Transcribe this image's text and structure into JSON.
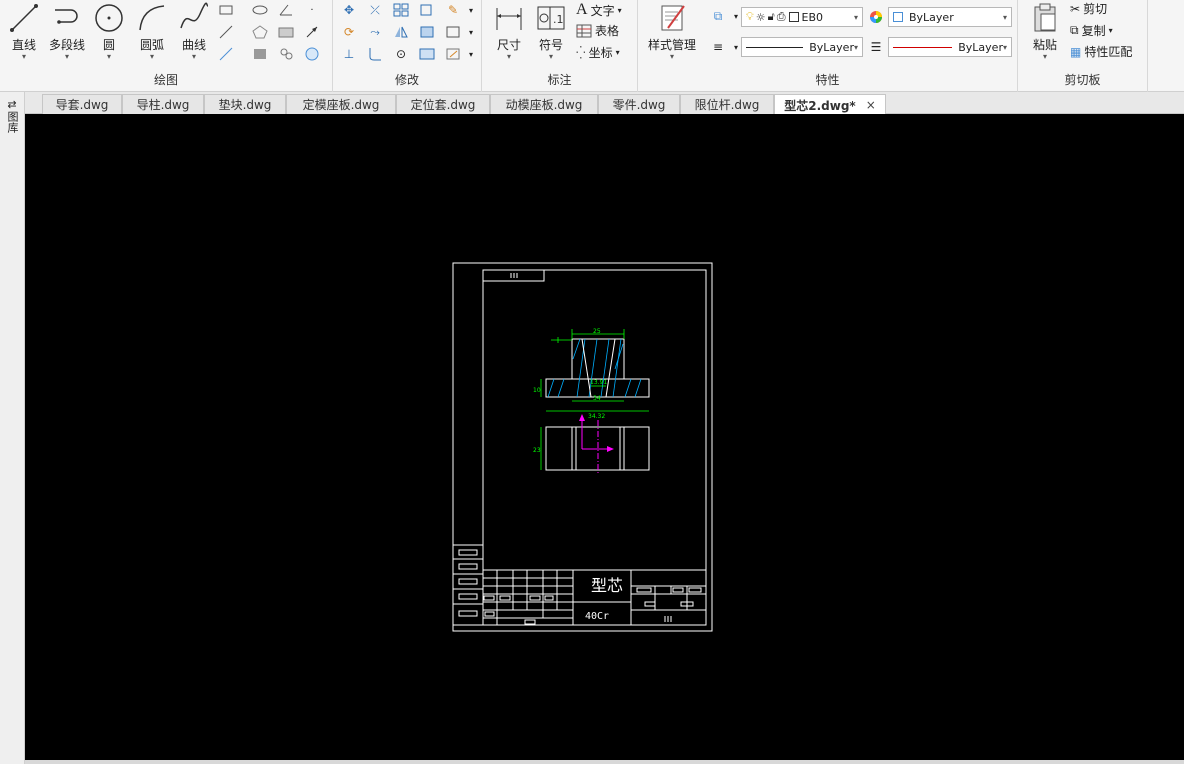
{
  "ribbon": {
    "draw": {
      "title": "绘图",
      "line": "直线",
      "polyline": "多段线",
      "circle": "圆",
      "arc": "圆弧",
      "curve": "曲线"
    },
    "modify": {
      "title": "修改"
    },
    "annotate": {
      "title": "标注",
      "dimension": "尺寸",
      "symbol": "符号",
      "text": "文字",
      "table": "表格",
      "coordinate": "坐标"
    },
    "properties": {
      "title": "特性",
      "style_manager": "样式管理",
      "layer_value": "EB0",
      "color_value": "ByLayer",
      "linetype_value": "ByLayer",
      "lineweight_value": "ByLayer"
    },
    "clipboard": {
      "title": "剪切板",
      "paste": "粘贴",
      "cut": "剪切",
      "copy": "复制",
      "match_properties": "特性匹配"
    }
  },
  "tabs": [
    {
      "label": "导套.dwg"
    },
    {
      "label": "导柱.dwg"
    },
    {
      "label": "垫块.dwg"
    },
    {
      "label": "定模座板.dwg"
    },
    {
      "label": "定位套.dwg"
    },
    {
      "label": "动模座板.dwg"
    },
    {
      "label": "零件.dwg"
    },
    {
      "label": "限位杆.dwg"
    },
    {
      "label": "型芯2.dwg*",
      "active": true
    }
  ],
  "tab_close": "×",
  "sidebar": {
    "label": "图库"
  },
  "drawing": {
    "title_block_name": "型芯",
    "material": "40Cr",
    "dim_top": "25",
    "dim_inner": "13.91",
    "dim_mid": "34",
    "dim_bottom": "34.32",
    "dim_left": "10",
    "dim_side": "23"
  },
  "colors": {
    "canvas_bg": "#000000",
    "cad_white": "#ffffff",
    "cad_green": "#00ff00",
    "cad_cyan": "#00b0ff",
    "cad_magenta": "#ff00ff",
    "linetype_red": "#d00000"
  }
}
